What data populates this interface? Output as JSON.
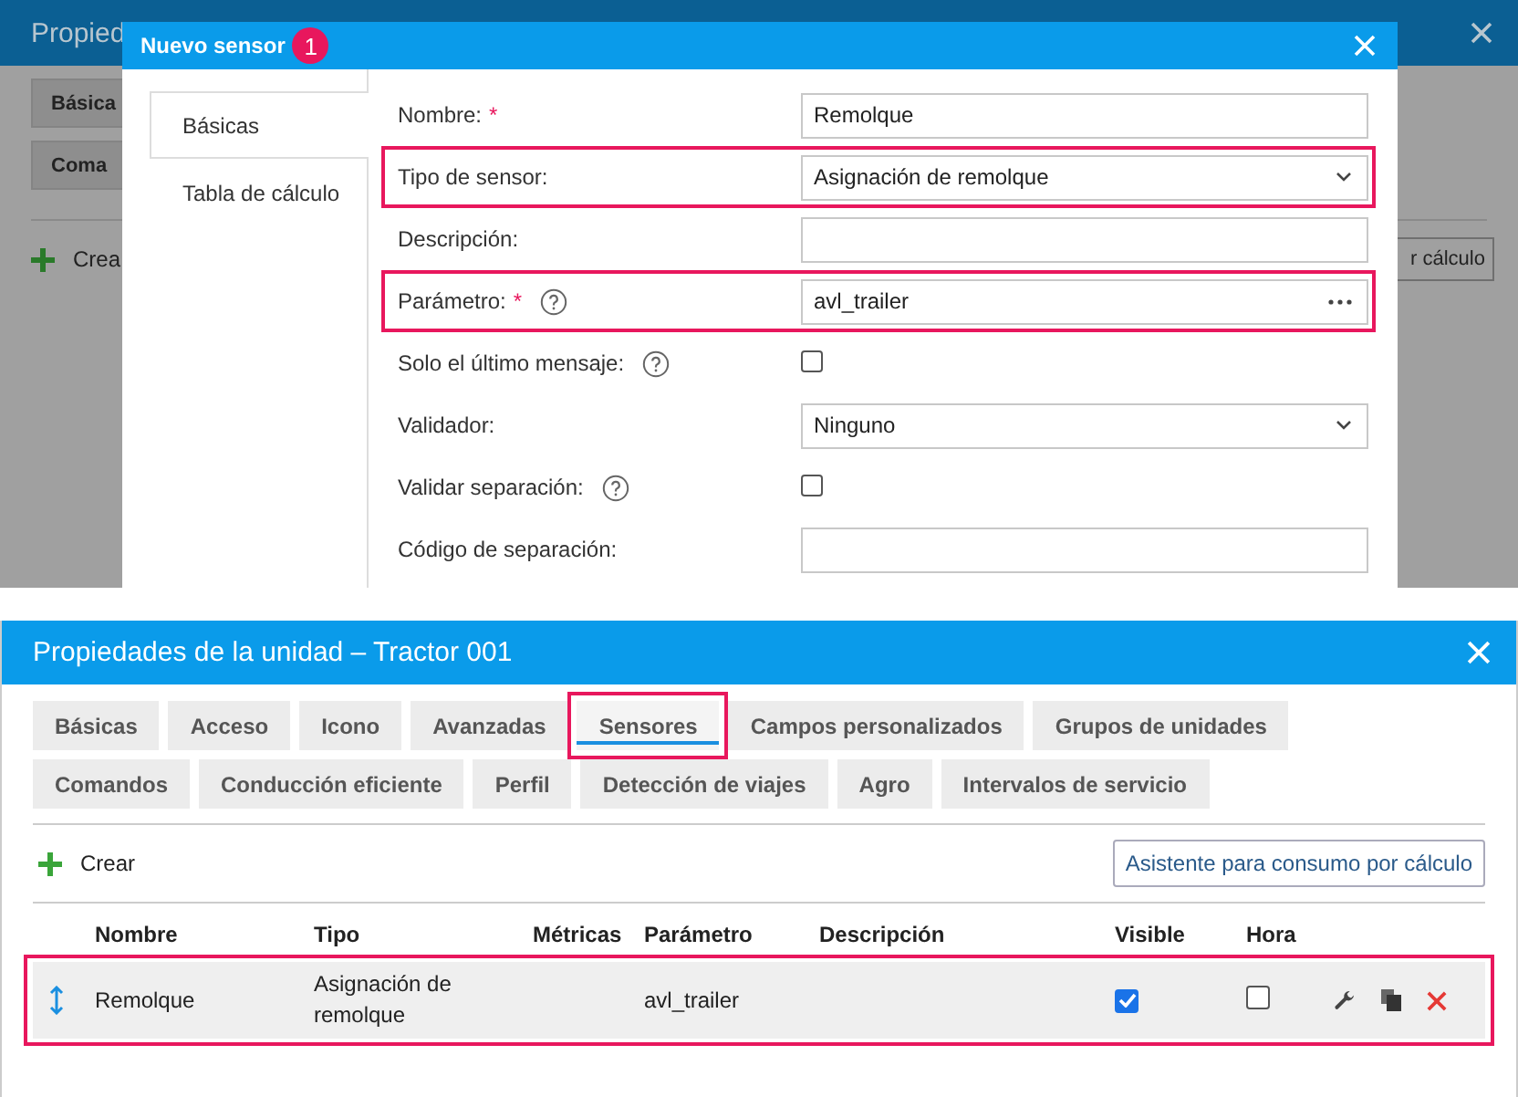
{
  "background_window": {
    "title": "Propied",
    "tabs": [
      "Básica",
      "Coma"
    ],
    "create_button": "Crea",
    "wizard_button": "r cálculo"
  },
  "dialog": {
    "title": "Nuevo sensor",
    "step_badge": "1",
    "tabs": [
      {
        "label": "Básicas",
        "selected": true
      },
      {
        "label": "Tabla de cálculo",
        "selected": false
      }
    ],
    "fields": [
      {
        "kind": "text",
        "label": "Nombre:",
        "required_mark": "*",
        "help": false,
        "value": "Remolque",
        "highlighted": false
      },
      {
        "kind": "select",
        "label": "Tipo de sensor:",
        "help": false,
        "value": "Asignación de remolque",
        "highlighted": true
      },
      {
        "kind": "text",
        "label": "Descripción:",
        "help": false,
        "highlighted": false
      },
      {
        "kind": "picker",
        "label": "Parámetro:",
        "required_mark": "*",
        "help": true,
        "value": "avl_trailer",
        "highlighted": true
      },
      {
        "kind": "checkbox",
        "label": "Solo el último mensaje:",
        "help": true,
        "checked": false,
        "highlighted": false
      },
      {
        "kind": "select",
        "label": "Validador:",
        "help": false,
        "value": "Ninguno",
        "highlighted": false
      },
      {
        "kind": "checkbox",
        "label": "Validar separación:",
        "help": true,
        "checked": false,
        "highlighted": false
      },
      {
        "kind": "text",
        "label": "Código de separación:",
        "help": false,
        "highlighted": false
      }
    ]
  },
  "unit_window": {
    "title": "Propiedades de la unidad – Tractor 001",
    "tab_rows": [
      [
        {
          "label": "Básicas",
          "selected": false,
          "highlighted": false
        },
        {
          "label": "Acceso",
          "selected": false,
          "highlighted": false
        },
        {
          "label": "Icono",
          "selected": false,
          "highlighted": false
        },
        {
          "label": "Avanzadas",
          "selected": false,
          "highlighted": false
        },
        {
          "label": "Sensores",
          "selected": true,
          "highlighted": true
        },
        {
          "label": "Campos personalizados",
          "selected": false,
          "highlighted": false
        },
        {
          "label": "Grupos de unidades",
          "selected": false,
          "highlighted": false
        }
      ],
      [
        {
          "label": "Comandos",
          "selected": false,
          "highlighted": false
        },
        {
          "label": "Conducción eficiente",
          "selected": false,
          "highlighted": false
        },
        {
          "label": "Perfil",
          "selected": false,
          "highlighted": false
        },
        {
          "label": "Detección de viajes",
          "selected": false,
          "highlighted": false
        },
        {
          "label": "Agro",
          "selected": false,
          "highlighted": false
        },
        {
          "label": "Intervalos de servicio",
          "selected": false,
          "highlighted": false
        }
      ]
    ],
    "create_button": "Crear",
    "wizard_button": "Asistente para consumo por cálculo",
    "table": {
      "columns": [
        "Nombre",
        "Tipo",
        "Métricas",
        "Parámetro",
        "Descripción",
        "Visible",
        "Hora"
      ],
      "rows": [
        {
          "name": "Remolque",
          "type": "Asignación de remolque",
          "parameter": "avl_trailer",
          "visible": true,
          "time": false,
          "highlighted": true
        }
      ]
    }
  }
}
